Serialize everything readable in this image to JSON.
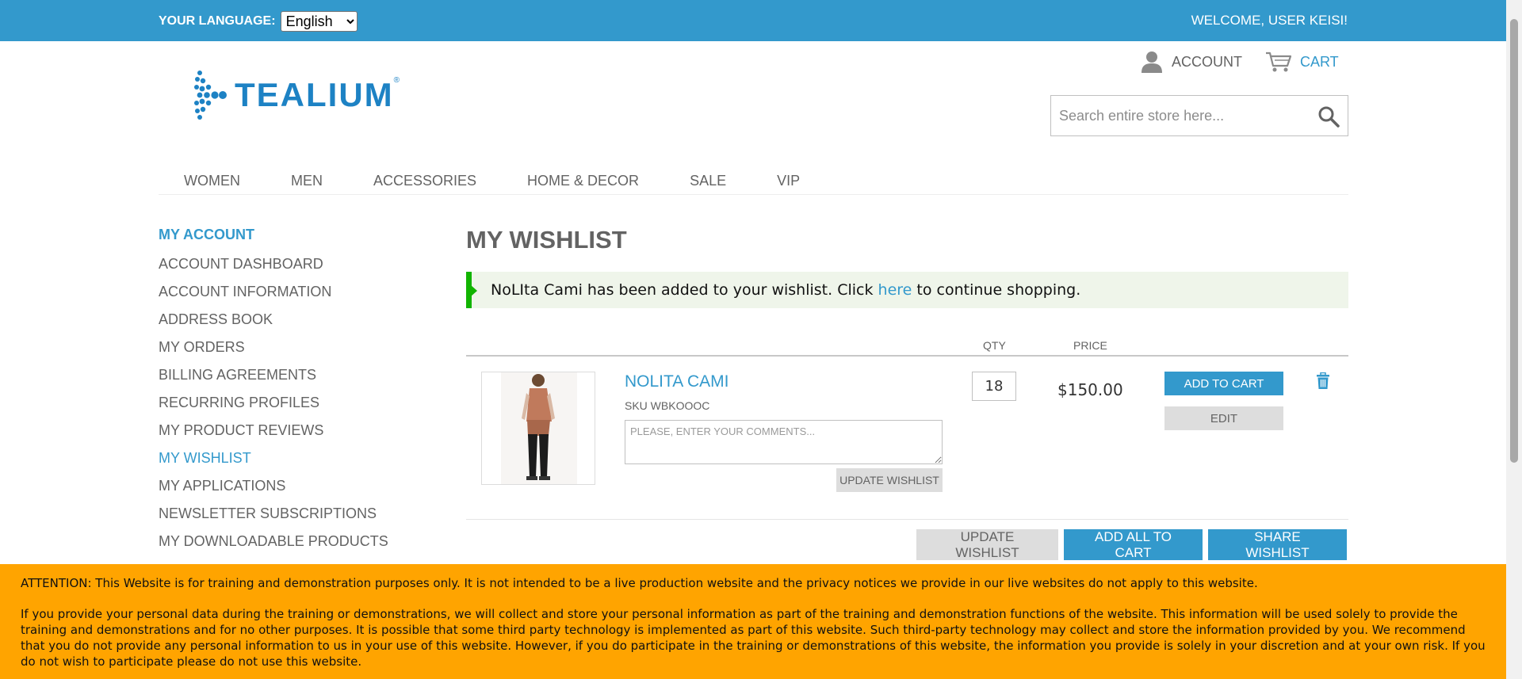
{
  "topbar": {
    "language_label": "YOUR LANGUAGE:",
    "language_value": "English",
    "welcome": "WELCOME, USER KEISI!"
  },
  "header": {
    "logo_text": "TEALIUM",
    "account_label": "ACCOUNT",
    "cart_label": "CART",
    "search_placeholder": "Search entire store here..."
  },
  "nav": {
    "items": [
      "WOMEN",
      "MEN",
      "ACCESSORIES",
      "HOME & DECOR",
      "SALE",
      "VIP"
    ]
  },
  "sidebar": {
    "title": "MY ACCOUNT",
    "items": [
      {
        "label": "ACCOUNT DASHBOARD"
      },
      {
        "label": "ACCOUNT INFORMATION"
      },
      {
        "label": "ADDRESS BOOK"
      },
      {
        "label": "MY ORDERS"
      },
      {
        "label": "BILLING AGREEMENTS"
      },
      {
        "label": "RECURRING PROFILES"
      },
      {
        "label": "MY PRODUCT REVIEWS"
      },
      {
        "label": "MY WISHLIST",
        "active": true
      },
      {
        "label": "MY APPLICATIONS"
      },
      {
        "label": "NEWSLETTER SUBSCRIPTIONS"
      },
      {
        "label": "MY DOWNLOADABLE PRODUCTS"
      }
    ]
  },
  "main": {
    "title": "MY WISHLIST",
    "message": {
      "before": "NoLIta Cami has been added to your wishlist. Click ",
      "link": "here",
      "after": " to continue shopping."
    },
    "columns": {
      "qty": "QTY",
      "price": "PRICE"
    },
    "item": {
      "name": "NOLITA CAMI",
      "sku": "SKU WBKoooC",
      "comment_placeholder": "PLEASE, ENTER YOUR COMMENTS...",
      "update_label": "UPDATE WISHLIST",
      "qty": "18",
      "price": "$150.00",
      "add_to_cart_label": "ADD TO CART",
      "edit_label": "EDIT"
    },
    "buttons": {
      "update_wishlist": "UPDATE WISHLIST",
      "add_all_to_cart": "ADD ALL TO CART",
      "share_wishlist": "SHARE WISHLIST"
    }
  },
  "notice": {
    "line1": "ATTENTION: This Website is for training and demonstration purposes only. It is not intended to be a live production website and the privacy notices we provide in our live websites do not apply to this website.",
    "line2": "If you provide your personal data during the training or demonstrations, we will collect and store your personal information as part of the training and demonstration functions of the website. This information will be used solely to provide the training and demonstrations and for no other purposes. It is possible that some third party technology is implemented as part of this website. Such third-party technology may collect and store the information provided by you. We recommend that you do not provide any personal information to us in your use of this website. However, if you do participate in the training or demonstrations of this website, the information you provide is solely in your discretion and at your own risk. If you do not wish to participate please do not use this website."
  },
  "colors": {
    "brand": "#3399cc",
    "success": "#11b400",
    "notice": "#ffa400"
  }
}
